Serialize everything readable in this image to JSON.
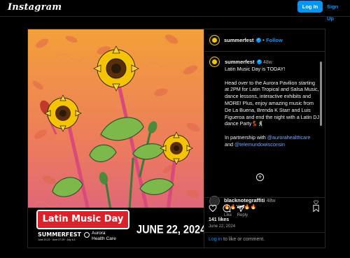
{
  "header": {
    "logo_text": "Instagram",
    "login_label": "Log In",
    "signup_label": "Sign Up"
  },
  "post": {
    "username": "summerfest",
    "follow_label": "Follow",
    "separator": "•",
    "image": {
      "event_title": "Latin Music Day",
      "brand": "SUMMERFEST",
      "brand_dates": "June 20-22 · June 27-29 · July 4-6",
      "sponsor_line1": "Aurora",
      "sponsor_line2": "Health Care",
      "date_text": "JUNE 22, 2024"
    },
    "caption": {
      "username": "summerfest",
      "age": "48w",
      "line1": "Latin Music Day is TODAY!",
      "body": "Head over to the Aurora Pavilion starting at 2PM for Latin Tropical and Salsa Music, dance lessons, interactive exhibits and MORE! Plus, enjoy amazing music from De La Buena, Brenda K Starr and Luis Figueroa and end the night with a Latin DJ dance Party💃🕺",
      "partnership_prefix": "In partnership with",
      "mention1": "@aurorahealthcare",
      "conj": "and",
      "mention2": "@telemundowisconsin"
    },
    "comment": {
      "username": "blacknotegraffiti",
      "age": "48w",
      "text": "🔥🔥Yes🔥🔥",
      "like_label": "Like",
      "reply_label": "Reply"
    },
    "likes_text": "141 likes",
    "date_text": "June 22, 2024",
    "login_prompt_link": "Log in",
    "login_prompt_rest": "to like or comment.",
    "more_comments_symbol": "+"
  },
  "colors": {
    "accent_blue": "#0095f6",
    "background": "#000000",
    "poster_top": "#f3a03a",
    "poster_bottom": "#d85a8a",
    "title_red": "#d8232a"
  },
  "icons": [
    "heart-icon",
    "comment-icon",
    "share-icon",
    "bookmark-icon",
    "verified-icon",
    "add-comment-icon",
    "comment-like-icon"
  ]
}
